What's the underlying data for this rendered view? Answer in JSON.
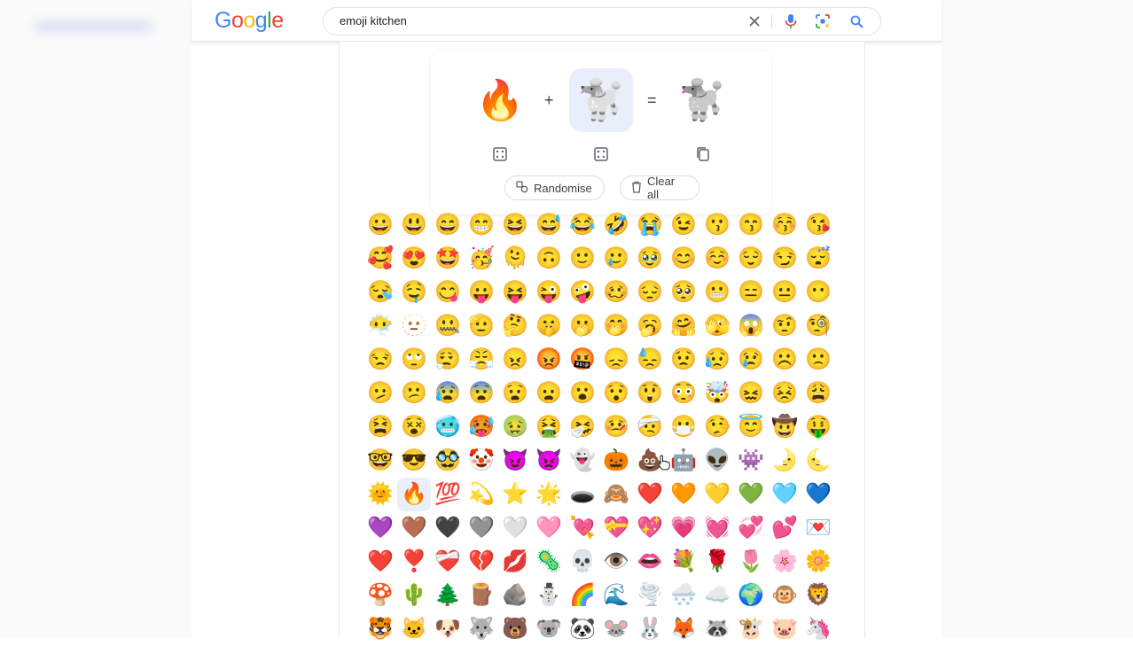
{
  "header": {
    "logo_letters": [
      {
        "ch": "G",
        "color": "#4285F4"
      },
      {
        "ch": "o",
        "color": "#EA4335"
      },
      {
        "ch": "o",
        "color": "#FBBC05"
      },
      {
        "ch": "g",
        "color": "#4285F4"
      },
      {
        "ch": "l",
        "color": "#34A853"
      },
      {
        "ch": "e",
        "color": "#EA4335"
      }
    ],
    "search_value": "emoji kitchen",
    "icons": [
      "close-icon",
      "mic-icon",
      "lens-icon",
      "search-icon"
    ]
  },
  "kitchen": {
    "left_emoji": "🔥",
    "plus": "+",
    "right_emoji": "🐩",
    "equals": "=",
    "result_emoji": "🐩",
    "randomise_label": "Randomise",
    "clear_label": "Clear all"
  },
  "grid": {
    "active_index": 113,
    "emojis": [
      "😀",
      "😃",
      "😄",
      "😁",
      "😆",
      "😅",
      "😂",
      "🤣",
      "😭",
      "😉",
      "😗",
      "😙",
      "😚",
      "😘",
      "🥰",
      "😍",
      "🤩",
      "🥳",
      "🫠",
      "🙃",
      "🙂",
      "🥲",
      "🥹",
      "😊",
      "☺️",
      "😌",
      "😏",
      "😴",
      "😪",
      "🤤",
      "😋",
      "😛",
      "😝",
      "😜",
      "🤪",
      "🥴",
      "😔",
      "🥺",
      "😬",
      "😑",
      "😐",
      "😶",
      "😶‍🌫️",
      "🫥",
      "🤐",
      "🫡",
      "🤔",
      "🤫",
      "🫢",
      "🤭",
      "🥱",
      "🤗",
      "🫣",
      "😱",
      "🤨",
      "🧐",
      "😒",
      "🙄",
      "😮‍💨",
      "😤",
      "😠",
      "😡",
      "🤬",
      "😞",
      "😓",
      "😟",
      "😥",
      "😢",
      "☹️",
      "🙁",
      "🫤",
      "😕",
      "😰",
      "😨",
      "😧",
      "😦",
      "😮",
      "😯",
      "😲",
      "😳",
      "🤯",
      "😖",
      "😣",
      "😩",
      "😫",
      "😵",
      "🥶",
      "🥵",
      "🤢",
      "🤮",
      "🤧",
      "🤒",
      "🤕",
      "😷",
      "🤥",
      "😇",
      "🤠",
      "🤑",
      "🤓",
      "😎",
      "🥸",
      "🤡",
      "😈",
      "👿",
      "👻",
      "🎃",
      "💩",
      "🤖",
      "👽",
      "👾",
      "🌛",
      "🌜",
      "🌞",
      "🔥",
      "💯",
      "💫",
      "⭐",
      "🌟",
      "🕳️",
      "🙈",
      "❤️",
      "🧡",
      "💛",
      "💚",
      "🩵",
      "💙",
      "💜",
      "🤎",
      "🖤",
      "🩶",
      "🤍",
      "🩷",
      "💘",
      "💝",
      "💖",
      "💗",
      "💓",
      "💞",
      "💕",
      "💌",
      "❤️",
      "❣️",
      "❤️‍🩹",
      "💔",
      "💋",
      "🦠",
      "💀",
      "👁️",
      "👄",
      "💐",
      "🌹",
      "🌷",
      "🌸",
      "🌼",
      "🍄",
      "🌵",
      "🌲",
      "🪵",
      "🪨",
      "⛄",
      "🌈",
      "🌊",
      "🌪️",
      "🌨️",
      "☁️",
      "🌍",
      "🐵",
      "🦁",
      "🐯",
      "🐱",
      "🐶",
      "🐺",
      "🐻",
      "🐨",
      "🐼",
      "🐭",
      "🐰",
      "🦊",
      "🦝",
      "🐮",
      "🐷",
      "🦄"
    ]
  },
  "colors": {
    "accent_blue": "#1a73e8",
    "selected_bg": "#e8effb",
    "mic_blue": "#4285F4"
  }
}
